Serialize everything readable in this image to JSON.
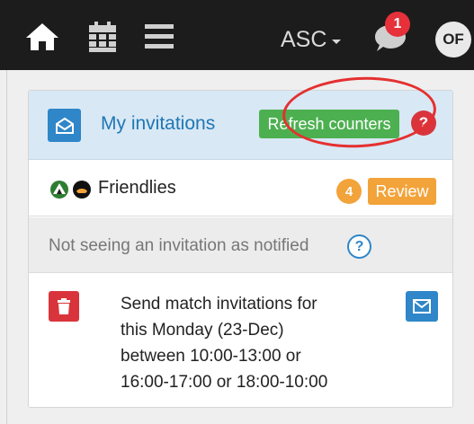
{
  "navbar": {
    "home_icon": "home-icon",
    "calendar_icon": "calendar-icon",
    "menu_icon": "menu-icon",
    "team_select": "ASC",
    "notifications_icon": "chat-bubble-icon",
    "notifications_count": "1",
    "avatar_initials": "OF"
  },
  "invitations": {
    "header_icon": "envelope-open-icon",
    "title": "My invitations",
    "refresh_label": "Refresh counters",
    "help_label": "?",
    "friendlies": {
      "label": "Friendlies",
      "count": "4",
      "review_label": "Review"
    },
    "notice": {
      "text": "Not seeing an invitation as notified",
      "help_label": "?"
    },
    "item": {
      "lines": [
        "Send match invitations for",
        "this Monday (23-Dec)",
        "between 10:00-13:00 or",
        "16:00-17:00 or 18:00-10:00"
      ],
      "delete_icon": "trash-icon",
      "send_icon": "envelope-icon"
    }
  },
  "colors": {
    "navbar_bg": "#1c1c1c",
    "primary": "#2f86c8",
    "success": "#4cb050",
    "warning": "#f2a33a",
    "danger": "#d9343c",
    "header_bg": "#d8e8f5"
  }
}
